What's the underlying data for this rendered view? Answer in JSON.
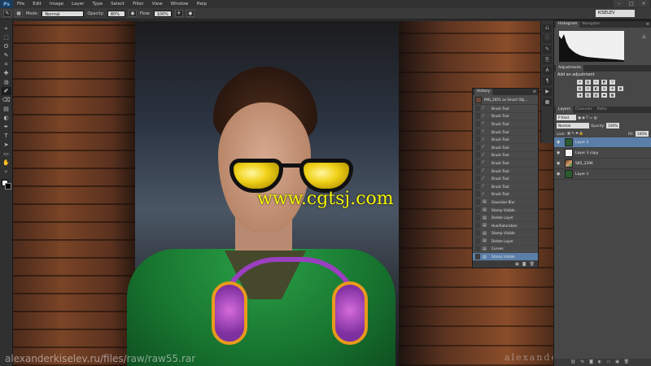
{
  "app": {
    "logo": "Ps"
  },
  "menu": [
    "File",
    "Edit",
    "Image",
    "Layer",
    "Type",
    "Select",
    "Filter",
    "View",
    "Window",
    "Help"
  ],
  "window_controls": [
    "–",
    "□",
    "×"
  ],
  "options_bar": {
    "mode_label": "Mode:",
    "mode_value": "Normal",
    "opacity_label": "Opacity:",
    "opacity_value": "80%",
    "flow_label": "Flow:",
    "flow_value": "100%",
    "workspace": "KISELEV"
  },
  "canvas": {
    "watermark": "www.cgtsj.com",
    "url_left": "alexanderkiselev.ru/files/raw/raw55.rar",
    "url_right": "alexanderkiselev.ru"
  },
  "tools": [
    "⌖",
    "⬚",
    "ʘ",
    "✎",
    "⌗",
    "✚",
    "◍",
    "✐",
    "⌫",
    "▤",
    "◐",
    "✒",
    "T",
    "➤",
    "▭",
    "✋",
    "⌕"
  ],
  "history": {
    "tabs": [
      "History"
    ],
    "snapshot": "IMG_2851 as Smart Obj...",
    "items": [
      {
        "label": "Brush Tool",
        "icon": "brush"
      },
      {
        "label": "Brush Tool",
        "icon": "brush"
      },
      {
        "label": "Brush Tool",
        "icon": "brush"
      },
      {
        "label": "Brush Tool",
        "icon": "brush"
      },
      {
        "label": "Brush Tool",
        "icon": "brush"
      },
      {
        "label": "Brush Tool",
        "icon": "brush"
      },
      {
        "label": "Brush Tool",
        "icon": "brush"
      },
      {
        "label": "Brush Tool",
        "icon": "brush"
      },
      {
        "label": "Brush Tool",
        "icon": "brush"
      },
      {
        "label": "Brush Tool",
        "icon": "brush"
      },
      {
        "label": "Brush Tool",
        "icon": "brush"
      },
      {
        "label": "Brush Tool",
        "icon": "brush"
      },
      {
        "label": "Gaussian Blur",
        "icon": "filter"
      },
      {
        "label": "Stamp Visible",
        "icon": "layer"
      },
      {
        "label": "Delete Layer",
        "icon": "layer"
      },
      {
        "label": "Hue/Saturation",
        "icon": "layer"
      },
      {
        "label": "Stamp Visible",
        "icon": "layer"
      },
      {
        "label": "Delete Layer",
        "icon": "layer"
      },
      {
        "label": "Curves",
        "icon": "layer"
      },
      {
        "label": "Stamp Visible",
        "icon": "layer"
      }
    ],
    "selected_index": 19
  },
  "dock": {
    "histogram_tabs": [
      "Histogram",
      "Navigator"
    ],
    "adjustments_tab": "Adjustments",
    "adjustments_heading": "Add an adjustment",
    "layers_tabs": [
      "Layers",
      "Channels",
      "Paths"
    ],
    "kind_value": "P Kind",
    "blend_value": "Normal",
    "opacity_label": "Opacity:",
    "opacity_value": "100%",
    "lock_label": "Lock:",
    "fill_label": "Fill:",
    "fill_value": "100%",
    "layers": [
      {
        "name": "Layer 2",
        "thumb": "green",
        "selected": true
      },
      {
        "name": "Layer 3 copy",
        "thumb": "white",
        "selected": false
      },
      {
        "name": "SKS_3296",
        "thumb": "photo",
        "selected": false
      },
      {
        "name": "Layer 1",
        "thumb": "green",
        "selected": false
      }
    ]
  },
  "colors": {
    "selection": "#5a7ea8",
    "panel": "#474747",
    "watermark": "#f5f50a"
  }
}
